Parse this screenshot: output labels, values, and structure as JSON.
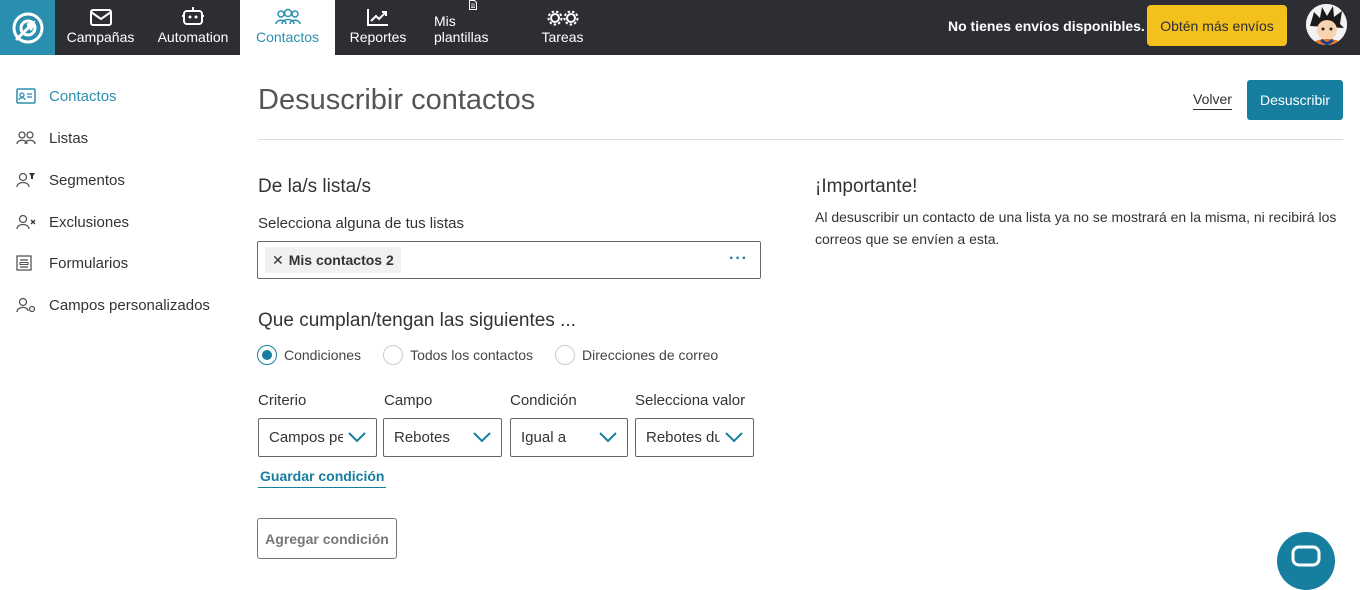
{
  "topbar": {
    "nav": [
      {
        "label": "Campañas",
        "icon": "envelope-icon"
      },
      {
        "label": "Automation",
        "icon": "robot-icon"
      },
      {
        "label": "Contactos",
        "icon": "people-icon",
        "active": true
      },
      {
        "label": "Reportes",
        "icon": "chart-trend-icon"
      },
      {
        "label": "Mis plantillas",
        "icon": "document-icon"
      },
      {
        "label": "Tareas",
        "icon": "gears-icon"
      }
    ],
    "status": "No tienes envíos disponibles.",
    "cta": "Obtén más envíos"
  },
  "sidebar": {
    "items": [
      {
        "label": "Contactos",
        "icon": "contact-card-icon",
        "active": true
      },
      {
        "label": "Listas",
        "icon": "people-icon"
      },
      {
        "label": "Segmentos",
        "icon": "user-filter-icon"
      },
      {
        "label": "Exclusiones",
        "icon": "user-x-icon"
      },
      {
        "label": "Formularios",
        "icon": "form-icon"
      },
      {
        "label": "Campos personalizados",
        "icon": "user-gear-icon"
      }
    ]
  },
  "header": {
    "title": "Desuscribir contactos",
    "back": "Volver",
    "primary": "Desuscribir"
  },
  "lists": {
    "heading": "De la/s lista/s",
    "label": "Selecciona alguna de tus listas",
    "selected": [
      "Mis contactos 2"
    ],
    "more": "···"
  },
  "conditions": {
    "heading": "Que cumplan/tengan las siguientes ...",
    "options": [
      {
        "label": "Condiciones",
        "checked": true
      },
      {
        "label": "Todos los contactos",
        "checked": false
      },
      {
        "label": "Direcciones de correo",
        "checked": false
      }
    ],
    "columns": [
      {
        "label": "Criterio",
        "value": "Campos personalizados"
      },
      {
        "label": "Campo",
        "value": "Rebotes"
      },
      {
        "label": "Condición",
        "value": "Igual a"
      },
      {
        "label": "Selecciona valor",
        "value": "Rebotes duros"
      }
    ],
    "save": "Guardar condición",
    "add": "Agregar condición"
  },
  "important": {
    "heading": "¡Importante!",
    "text": "Al desuscribir un contacto de una lista ya no se mostrará en la misma, ni recibirá los correos que se envíen a esta."
  },
  "colors": {
    "topbar": "#2c2e33",
    "brand": "#2a8fae",
    "primary": "#167f9f",
    "cta": "#f4c01b"
  }
}
